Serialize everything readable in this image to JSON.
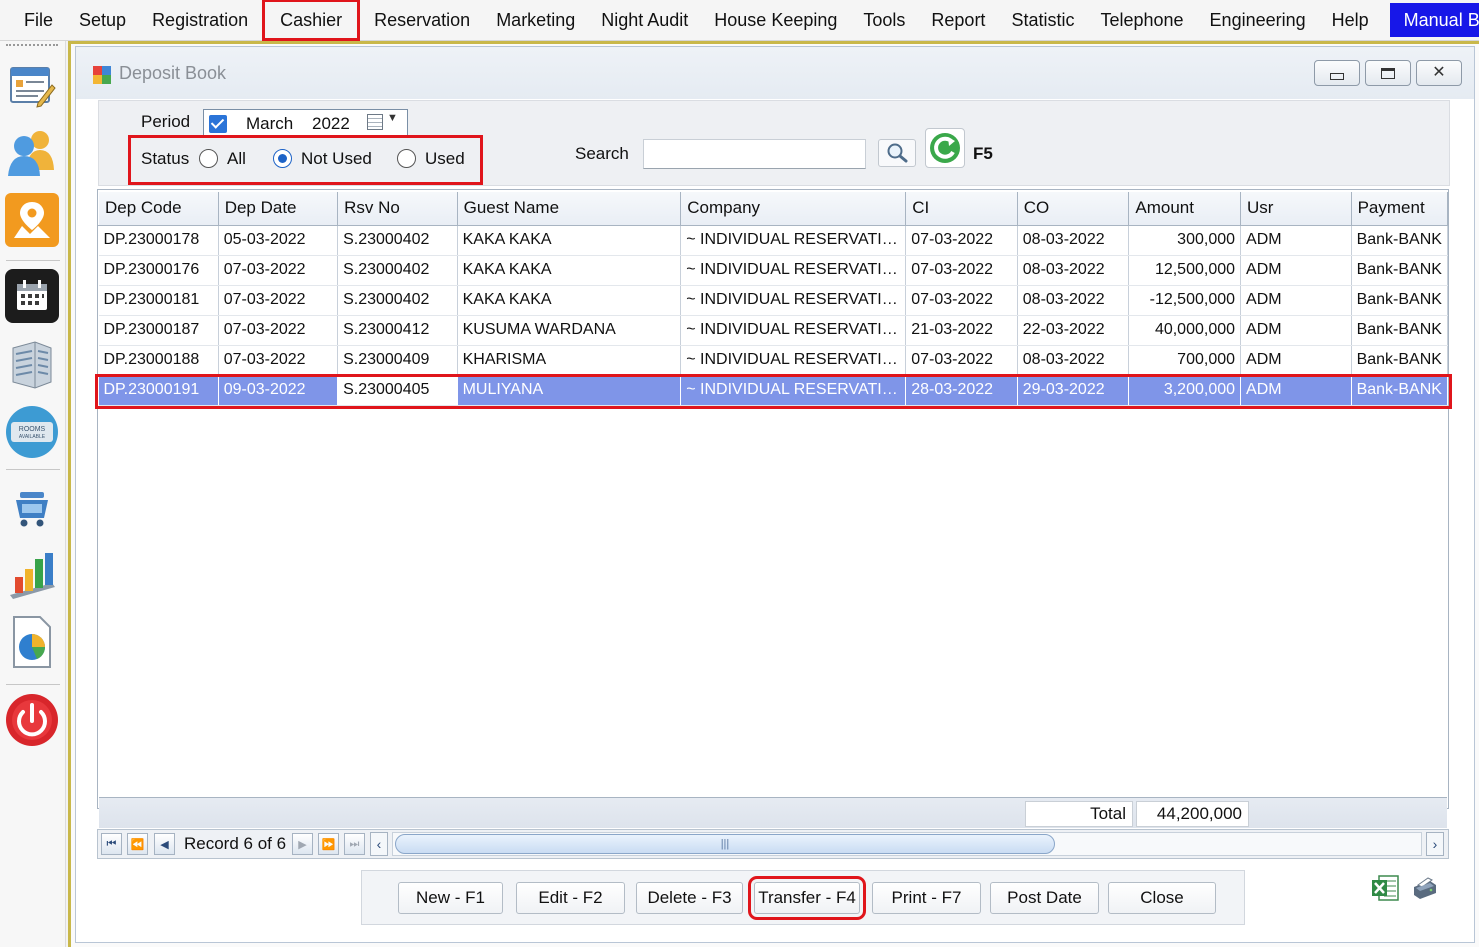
{
  "menu": [
    "File",
    "Setup",
    "Registration",
    "Cashier",
    "Reservation",
    "Marketing",
    "Night Audit",
    "House Keeping",
    "Tools",
    "Report",
    "Statistic",
    "Telephone",
    "Engineering",
    "Help"
  ],
  "menu_right": "Manual B",
  "window": {
    "title": "Deposit Book"
  },
  "filter": {
    "period_label": "Period",
    "period_month": "March",
    "period_year": "2022",
    "status_label": "Status",
    "status_options": [
      "All",
      "Not Used",
      "Used"
    ],
    "status_selected": "Not Used",
    "search_label": "Search",
    "search_value": "",
    "refresh_shortcut": "F5"
  },
  "table": {
    "columns": [
      "Dep Code",
      "Dep Date",
      "Rsv No",
      "Guest Name",
      "Company",
      "CI",
      "CO",
      "Amount",
      "Usr",
      "Payment"
    ],
    "rows": [
      [
        "DP.23000178",
        "05-03-2022",
        "S.23000402",
        "KAKA KAKA",
        "~ INDIVIDUAL RESERVATI…",
        "07-03-2022",
        "08-03-2022",
        "300,000",
        "ADM",
        "Bank-BANK"
      ],
      [
        "DP.23000176",
        "07-03-2022",
        "S.23000402",
        "KAKA KAKA",
        "~ INDIVIDUAL RESERVATI…",
        "07-03-2022",
        "08-03-2022",
        "12,500,000",
        "ADM",
        "Bank-BANK"
      ],
      [
        "DP.23000181",
        "07-03-2022",
        "S.23000402",
        "KAKA KAKA",
        "~ INDIVIDUAL RESERVATI…",
        "07-03-2022",
        "08-03-2022",
        "-12,500,000",
        "ADM",
        "Bank-BANK"
      ],
      [
        "DP.23000187",
        "07-03-2022",
        "S.23000412",
        "KUSUMA WARDANA",
        "~ INDIVIDUAL RESERVATI…",
        "21-03-2022",
        "22-03-2022",
        "40,000,000",
        "ADM",
        "Bank-BANK"
      ],
      [
        "DP.23000188",
        "07-03-2022",
        "S.23000409",
        "KHARISMA",
        "~ INDIVIDUAL RESERVATI…",
        "07-03-2022",
        "08-03-2022",
        "700,000",
        "ADM",
        "Bank-BANK"
      ],
      [
        "DP.23000191",
        "09-03-2022",
        "S.23000405",
        "MULIYANA",
        "~ INDIVIDUAL RESERVATI…",
        "28-03-2022",
        "29-03-2022",
        "3,200,000",
        "ADM",
        "Bank-BANK"
      ]
    ],
    "selected_row": 5,
    "total_label": "Total",
    "total_value": "44,200,000"
  },
  "navigator": {
    "record_text": "Record 6 of 6"
  },
  "buttons": {
    "new": "New - F1",
    "edit": "Edit - F2",
    "delete": "Delete - F3",
    "transfer": "Transfer - F4",
    "print": "Print - F7",
    "post_date": "Post Date",
    "close": "Close"
  },
  "colors": {
    "highlight_red": "#e0151b",
    "selected_row": "#7f95e8",
    "manual_menu_bg": "#1717e8"
  },
  "icons": [
    "registration-icon",
    "guests-icon",
    "map-icon",
    "calendar-icon",
    "building-icon",
    "rooms-available-icon",
    "shop-cart-icon",
    "chart-icon",
    "report-pie-icon",
    "power-icon"
  ]
}
